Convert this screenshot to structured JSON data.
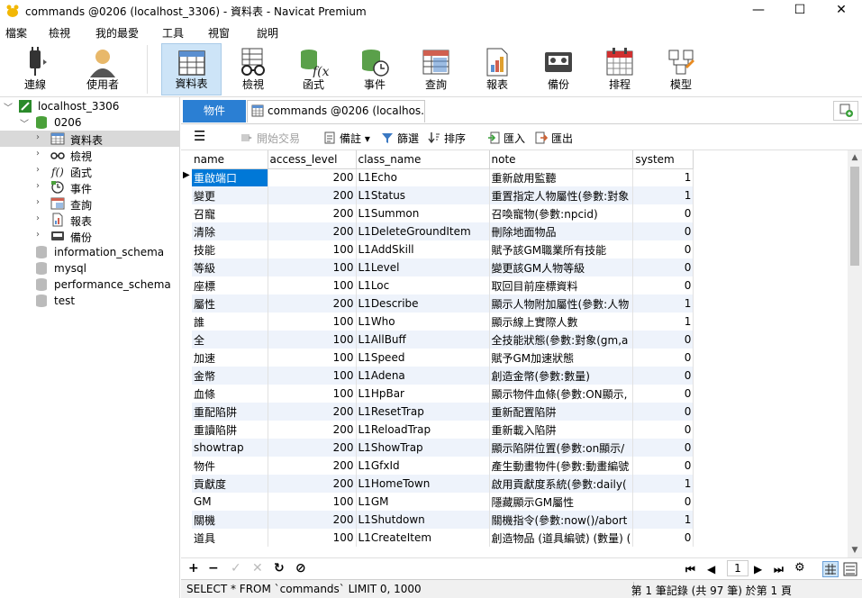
{
  "window": {
    "title": "commands @0206 (localhost_3306) - 資料表 - Navicat Premium",
    "minimize": "—",
    "maximize": "☐",
    "close": "✕"
  },
  "menu": [
    "檔案",
    "檢視",
    "我的最愛",
    "工具",
    "視窗",
    "說明"
  ],
  "toolbar": {
    "connect": "連線",
    "user": "使用者",
    "table": "資料表",
    "view": "檢視",
    "function": "函式",
    "event": "事件",
    "query": "查詢",
    "report": "報表",
    "backup": "備份",
    "schedule": "排程",
    "model": "模型"
  },
  "sidebar": {
    "connection": "localhost_3306",
    "database": "0206",
    "items": [
      "資料表",
      "檢視",
      "函式",
      "事件",
      "查詢",
      "報表",
      "備份"
    ],
    "other_dbs": [
      "information_schema",
      "mysql",
      "performance_schema",
      "test"
    ]
  },
  "tabs": {
    "objects": "物件",
    "commands": "commands @0206 (localhos..."
  },
  "subtoolbar": {
    "begin_transaction": "開始交易",
    "memo": "備註",
    "filter": "篩選",
    "sort": "排序",
    "import": "匯入",
    "export": "匯出"
  },
  "grid": {
    "columns": [
      "name",
      "access_level",
      "class_name",
      "note",
      "system"
    ],
    "rows": [
      [
        "重啟端口",
        "200",
        "L1Echo",
        "重新啟用監聽",
        "1"
      ],
      [
        "變更",
        "200",
        "L1Status",
        "重置指定人物屬性(參數:對象",
        "1"
      ],
      [
        "召寵",
        "200",
        "L1Summon",
        "召喚寵物(參數:npcid)",
        "0"
      ],
      [
        "清除",
        "200",
        "L1DeleteGroundItem",
        "刪除地面物品",
        "0"
      ],
      [
        "技能",
        "100",
        "L1AddSkill",
        "賦予該GM職業所有技能",
        "0"
      ],
      [
        "等級",
        "100",
        "L1Level",
        "變更該GM人物等級",
        "0"
      ],
      [
        "座標",
        "100",
        "L1Loc",
        "取回目前座標資料",
        "0"
      ],
      [
        "屬性",
        "200",
        "L1Describe",
        "顯示人物附加屬性(參數:人物",
        "1"
      ],
      [
        "誰",
        "100",
        "L1Who",
        "顯示線上實際人數",
        "1"
      ],
      [
        "全",
        "100",
        "L1AllBuff",
        "全技能狀態(參數:對象(gm,a",
        "0"
      ],
      [
        "加速",
        "100",
        "L1Speed",
        "賦予GM加速狀態",
        "0"
      ],
      [
        "金幣",
        "100",
        "L1Adena",
        "創造金幣(參數:數量)",
        "0"
      ],
      [
        "血條",
        "100",
        "L1HpBar",
        "顯示物件血條(參數:ON顯示,",
        "0"
      ],
      [
        "重配陷阱",
        "200",
        "L1ResetTrap",
        "重新配置陷阱",
        "0"
      ],
      [
        "重讀陷阱",
        "200",
        "L1ReloadTrap",
        "重新載入陷阱",
        "0"
      ],
      [
        "showtrap",
        "200",
        "L1ShowTrap",
        "顯示陷阱位置(參數:on顯示/",
        "0"
      ],
      [
        "物件",
        "200",
        "L1GfxId",
        "產生動畫物件(參數:動畫編號",
        "0"
      ],
      [
        "貢獻度",
        "200",
        "L1HomeTown",
        "啟用貢獻度系統(參數:daily(",
        "1"
      ],
      [
        "GM",
        "100",
        "L1GM",
        "隱藏顯示GM屬性",
        "0"
      ],
      [
        "關機",
        "200",
        "L1Shutdown",
        "關機指令(參數:now()/abort",
        "1"
      ],
      [
        "道具",
        "100",
        "L1CreateItem",
        "創造物品 (道具編號) (數量) (",
        "0"
      ]
    ]
  },
  "pager": {
    "page": "1"
  },
  "status": {
    "sql": "SELECT * FROM `commands` LIMIT 0, 1000",
    "record": "第 1 筆記錄 (共 97 筆) 於第 1 頁"
  }
}
